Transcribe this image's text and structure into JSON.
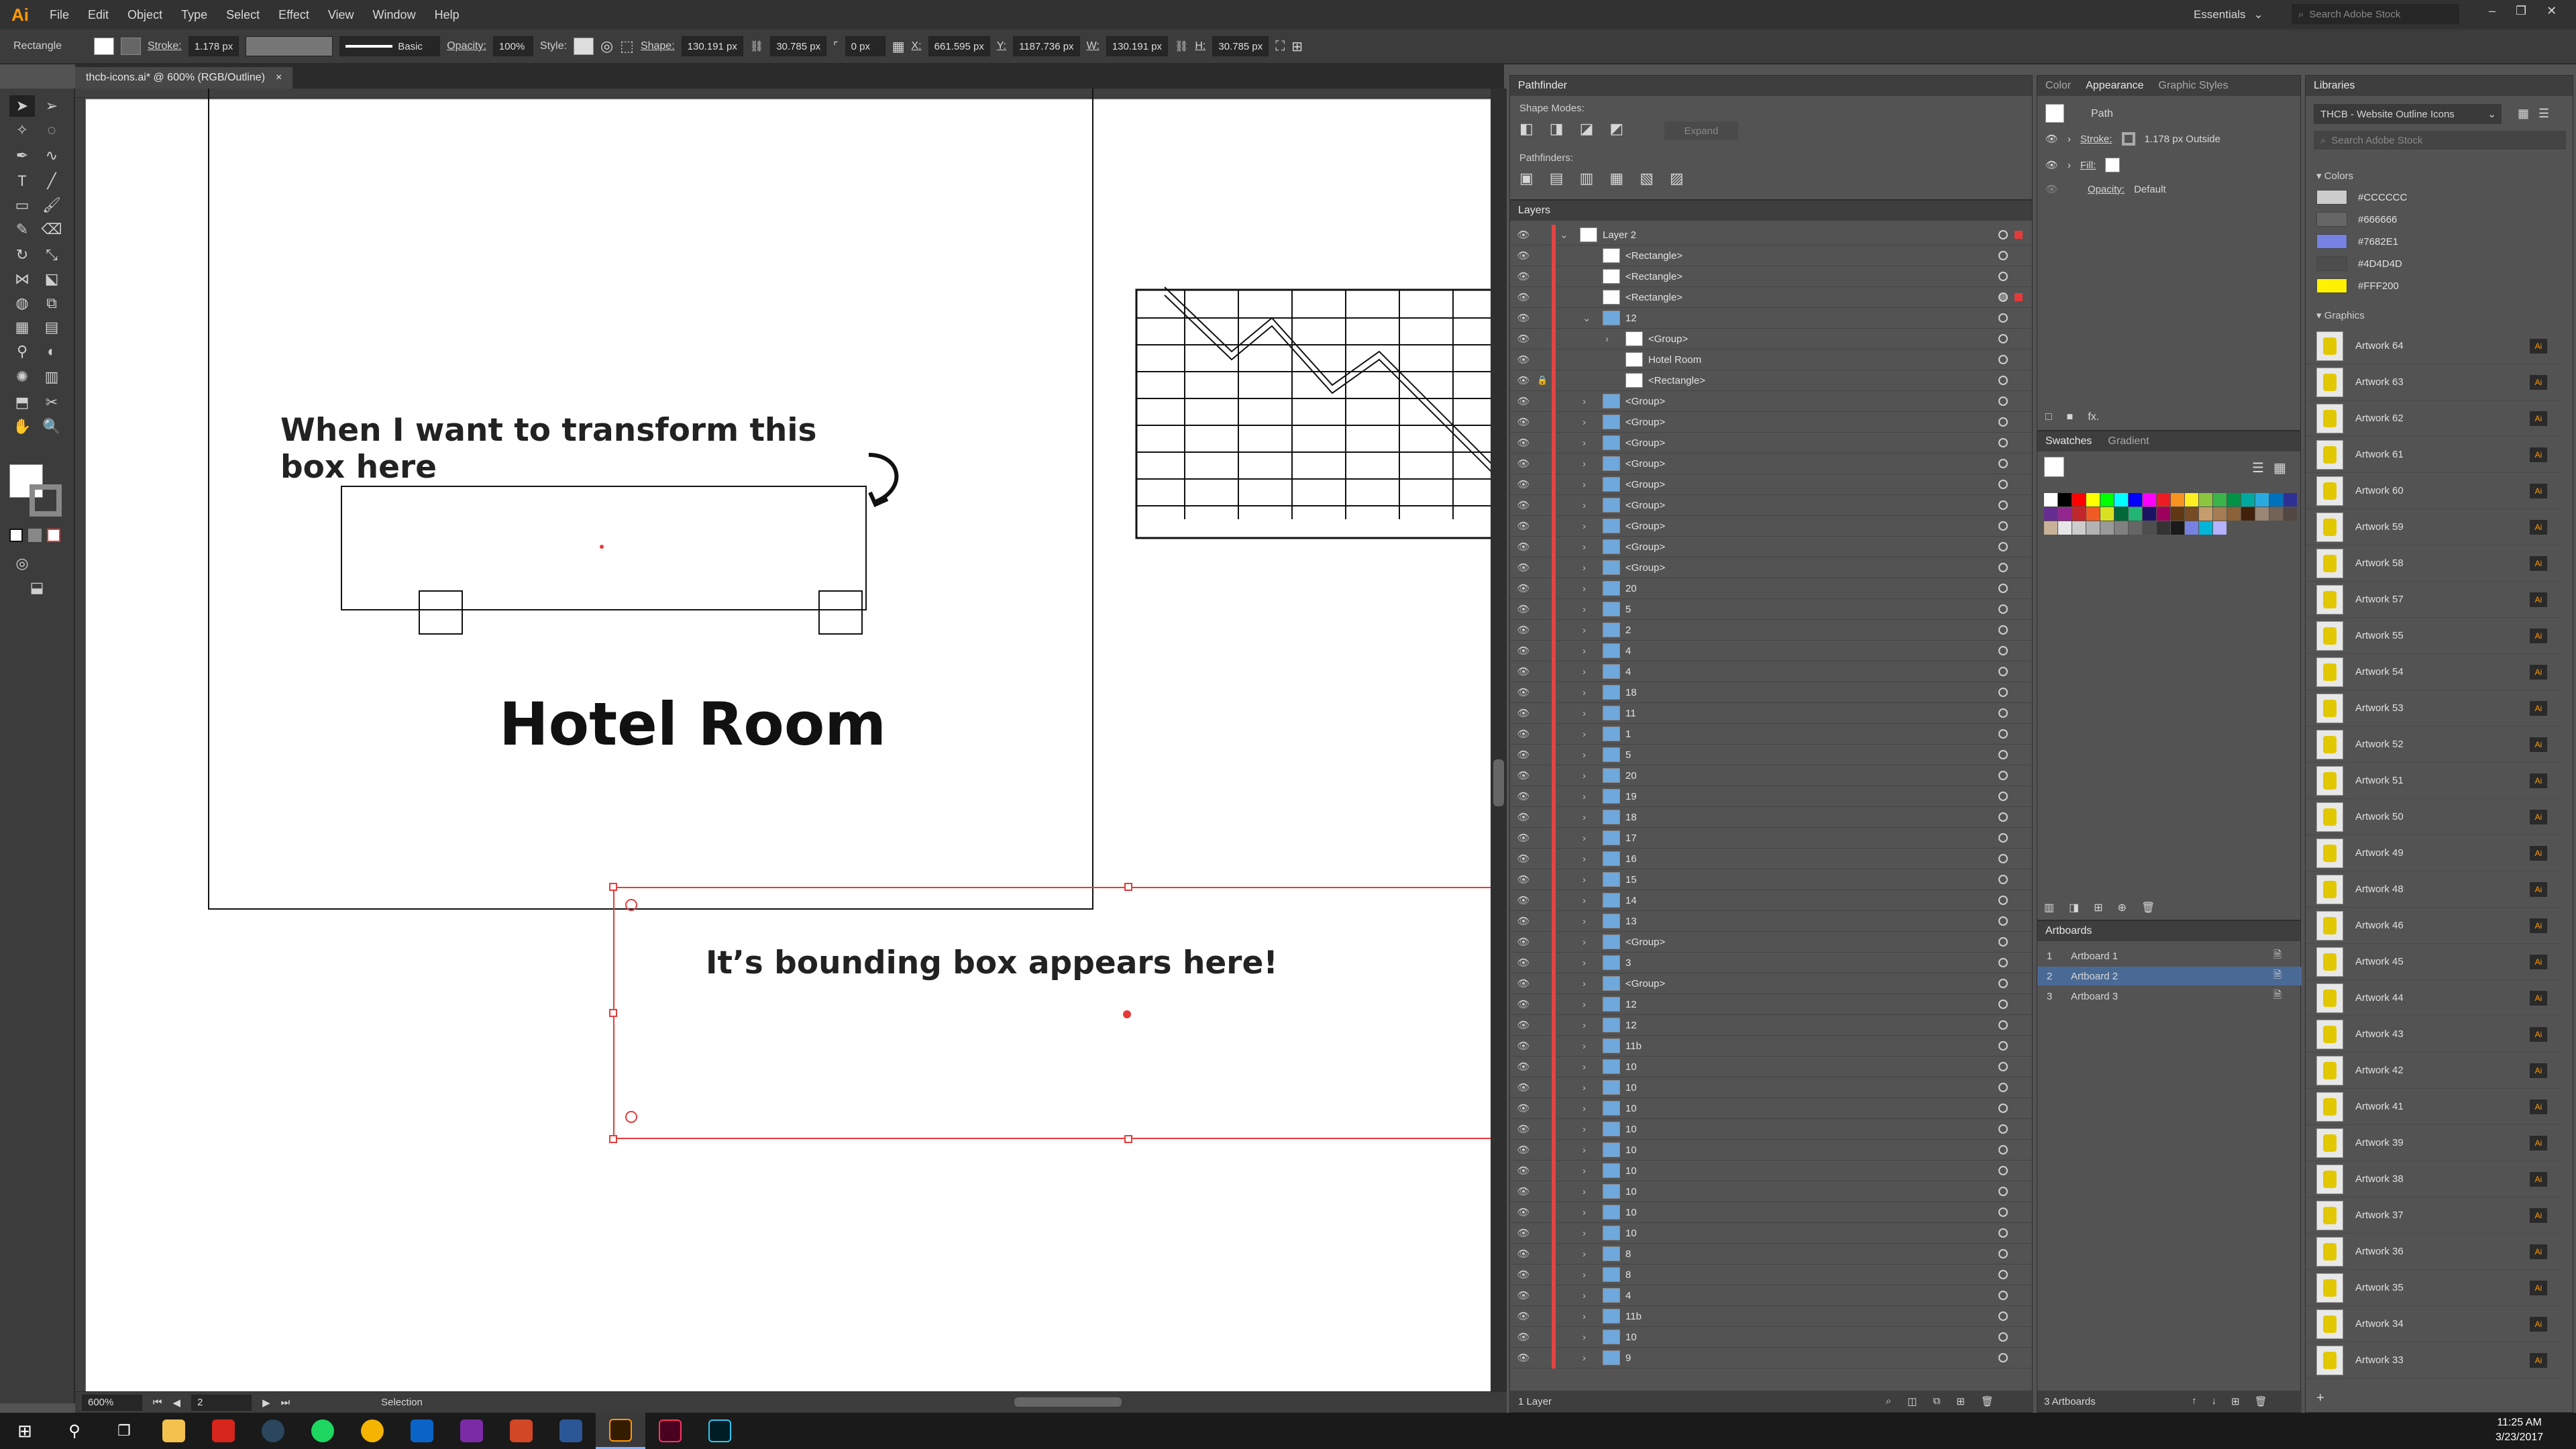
{
  "app": {
    "logo": "Ai"
  },
  "menu": [
    "File",
    "Edit",
    "Object",
    "Type",
    "Select",
    "Effect",
    "View",
    "Window",
    "Help"
  ],
  "workspace": {
    "label": "Essentials",
    "search_placeholder": "Search Adobe Stock"
  },
  "control": {
    "object_type": "Rectangle",
    "stroke_label": "Stroke:",
    "stroke_value": "1.178 px",
    "brush_label": "Basic",
    "opacity_label": "Opacity:",
    "opacity_value": "100%",
    "style_label": "Style:",
    "shape_label": "Shape:",
    "shape_w": "130.191 px",
    "shape_h": "30.785 px",
    "corner": "0 px",
    "x_label": "X:",
    "x_value": "661.595 px",
    "y_label": "Y:",
    "y_value": "1187.736 px",
    "w_label": "W:",
    "w_value": "130.191 px",
    "h_label": "H:",
    "h_value": "30.785 px"
  },
  "document": {
    "tab": "thcb-icons.ai* @ 600% (RGB/Outline)",
    "close": "×"
  },
  "artboard": {
    "caption_top": "When I want to transform this box here",
    "title": "Hotel Room",
    "caption_bottom": "It’s bounding box appears here!"
  },
  "status": {
    "zoom": "600%",
    "artboard_num": "2",
    "tool": "Selection"
  },
  "pathfinder": {
    "title": "Pathfinder",
    "shape_modes": "Shape Modes:",
    "expand": "Expand",
    "pathfinders": "Pathfinders:"
  },
  "layers": {
    "title": "Layers",
    "footer": "1 Layer",
    "rows": [
      {
        "name": "Layer 2",
        "indent": 0,
        "expand": "open",
        "thumb": "white"
      },
      {
        "name": "<Rectangle>",
        "indent": 1,
        "expand": "",
        "thumb": "white"
      },
      {
        "name": "<Rectangle>",
        "indent": 1,
        "expand": "",
        "thumb": "white"
      },
      {
        "name": "<Rectangle>",
        "indent": 1,
        "expand": "",
        "thumb": "white"
      },
      {
        "name": "12",
        "indent": 1,
        "expand": "open",
        "thumb": "blue"
      },
      {
        "name": "<Group>",
        "indent": 2,
        "expand": "closed",
        "thumb": "white"
      },
      {
        "name": "Hotel Room",
        "indent": 2,
        "expand": "",
        "thumb": "white"
      },
      {
        "name": "<Rectangle>",
        "indent": 2,
        "expand": "",
        "thumb": "white"
      },
      {
        "name": "<Group>",
        "indent": 1,
        "expand": "closed",
        "thumb": "blue"
      },
      {
        "name": "<Group>",
        "indent": 1,
        "expand": "closed",
        "thumb": "blue"
      },
      {
        "name": "<Group>",
        "indent": 1,
        "expand": "closed",
        "thumb": "blue"
      },
      {
        "name": "<Group>",
        "indent": 1,
        "expand": "closed",
        "thumb": "blue"
      },
      {
        "name": "<Group>",
        "indent": 1,
        "expand": "closed",
        "thumb": "blue"
      },
      {
        "name": "<Group>",
        "indent": 1,
        "expand": "closed",
        "thumb": "blue"
      },
      {
        "name": "<Group>",
        "indent": 1,
        "expand": "closed",
        "thumb": "blue"
      },
      {
        "name": "<Group>",
        "indent": 1,
        "expand": "closed",
        "thumb": "blue"
      },
      {
        "name": "<Group>",
        "indent": 1,
        "expand": "closed",
        "thumb": "blue"
      },
      {
        "name": "20",
        "indent": 1,
        "expand": "closed",
        "thumb": "blue"
      },
      {
        "name": "5",
        "indent": 1,
        "expand": "closed",
        "thumb": "blue"
      },
      {
        "name": "2",
        "indent": 1,
        "expand": "closed",
        "thumb": "blue"
      },
      {
        "name": "4",
        "indent": 1,
        "expand": "closed",
        "thumb": "blue"
      },
      {
        "name": "4",
        "indent": 1,
        "expand": "closed",
        "thumb": "blue"
      },
      {
        "name": "18",
        "indent": 1,
        "expand": "closed",
        "thumb": "blue"
      },
      {
        "name": "11",
        "indent": 1,
        "expand": "closed",
        "thumb": "blue"
      },
      {
        "name": "1",
        "indent": 1,
        "expand": "closed",
        "thumb": "blue"
      },
      {
        "name": "5",
        "indent": 1,
        "expand": "closed",
        "thumb": "blue"
      },
      {
        "name": "20",
        "indent": 1,
        "expand": "closed",
        "thumb": "blue"
      },
      {
        "name": "19",
        "indent": 1,
        "expand": "closed",
        "thumb": "blue"
      },
      {
        "name": "18",
        "indent": 1,
        "expand": "closed",
        "thumb": "blue"
      },
      {
        "name": "17",
        "indent": 1,
        "expand": "closed",
        "thumb": "blue"
      },
      {
        "name": "16",
        "indent": 1,
        "expand": "closed",
        "thumb": "blue"
      },
      {
        "name": "15",
        "indent": 1,
        "expand": "closed",
        "thumb": "blue"
      },
      {
        "name": "14",
        "indent": 1,
        "expand": "closed",
        "thumb": "blue"
      },
      {
        "name": "13",
        "indent": 1,
        "expand": "closed",
        "thumb": "blue"
      },
      {
        "name": "<Group>",
        "indent": 1,
        "expand": "closed",
        "thumb": "blue"
      },
      {
        "name": "3",
        "indent": 1,
        "expand": "closed",
        "thumb": "blue"
      },
      {
        "name": "<Group>",
        "indent": 1,
        "expand": "closed",
        "thumb": "blue"
      },
      {
        "name": "12",
        "indent": 1,
        "expand": "closed",
        "thumb": "blue"
      },
      {
        "name": "12",
        "indent": 1,
        "expand": "closed",
        "thumb": "blue"
      },
      {
        "name": "11b",
        "indent": 1,
        "expand": "closed",
        "thumb": "blue"
      },
      {
        "name": "10",
        "indent": 1,
        "expand": "closed",
        "thumb": "blue"
      },
      {
        "name": "10",
        "indent": 1,
        "expand": "closed",
        "thumb": "blue"
      },
      {
        "name": "10",
        "indent": 1,
        "expand": "closed",
        "thumb": "blue"
      },
      {
        "name": "10",
        "indent": 1,
        "expand": "closed",
        "thumb": "blue"
      },
      {
        "name": "10",
        "indent": 1,
        "expand": "closed",
        "thumb": "blue"
      },
      {
        "name": "10",
        "indent": 1,
        "expand": "closed",
        "thumb": "blue"
      },
      {
        "name": "10",
        "indent": 1,
        "expand": "closed",
        "thumb": "blue"
      },
      {
        "name": "10",
        "indent": 1,
        "expand": "closed",
        "thumb": "blue"
      },
      {
        "name": "10",
        "indent": 1,
        "expand": "closed",
        "thumb": "blue"
      },
      {
        "name": "8",
        "indent": 1,
        "expand": "closed",
        "thumb": "blue"
      },
      {
        "name": "8",
        "indent": 1,
        "expand": "closed",
        "thumb": "blue"
      },
      {
        "name": "4",
        "indent": 1,
        "expand": "closed",
        "thumb": "blue"
      },
      {
        "name": "11b",
        "indent": 1,
        "expand": "closed",
        "thumb": "blue"
      },
      {
        "name": "10",
        "indent": 1,
        "expand": "closed",
        "thumb": "blue"
      },
      {
        "name": "9",
        "indent": 1,
        "expand": "closed",
        "thumb": "blue"
      }
    ]
  },
  "appearance": {
    "tabs": [
      "Color",
      "Appearance",
      "Graphic Styles"
    ],
    "target": "Path",
    "stroke_label": "Stroke:",
    "stroke_value": "1.178 px  Outside",
    "fill_label": "Fill:",
    "opacity_label": "Opacity:",
    "opacity_value": "Default",
    "fx": "fx."
  },
  "swatches": {
    "tabs": [
      "Swatches",
      "Gradient"
    ]
  },
  "artboards": {
    "title": "Artboards",
    "footer": "3 Artboards",
    "items": [
      {
        "num": "1",
        "name": "Artboard 1"
      },
      {
        "num": "2",
        "name": "Artboard 2"
      },
      {
        "num": "3",
        "name": "Artboard 3"
      }
    ]
  },
  "libraries": {
    "title": "Libraries",
    "library_name": "THCB - Website Outline Icons",
    "search_placeholder": "Search Adobe Stock",
    "colors_heading": "Colors",
    "colors": [
      {
        "name": "#CCCCCC",
        "hex": "#CCCCCC"
      },
      {
        "name": "#666666",
        "hex": "#666666"
      },
      {
        "name": "#7682E1",
        "hex": "#7682E1"
      },
      {
        "name": "#4D4D4D",
        "hex": "#4D4D4D"
      },
      {
        "name": "#FFF200",
        "hex": "#FFF200"
      }
    ],
    "graphics_heading": "Graphics",
    "graphics": [
      "Artwork 64",
      "Artwork 63",
      "Artwork 62",
      "Artwork 61",
      "Artwork 60",
      "Artwork 59",
      "Artwork 58",
      "Artwork 57",
      "Artwork 55",
      "Artwork 54",
      "Artwork 53",
      "Artwork 52",
      "Artwork 51",
      "Artwork 50",
      "Artwork 49",
      "Artwork 48",
      "Artwork 46",
      "Artwork 45",
      "Artwork 44",
      "Artwork 43",
      "Artwork 42",
      "Artwork 41",
      "Artwork 39",
      "Artwork 38",
      "Artwork 37",
      "Artwork 36",
      "Artwork 35",
      "Artwork 34",
      "Artwork 33"
    ],
    "badge": "Ai"
  },
  "taskbar": {
    "time": "11:25 AM",
    "date": "3/23/2017"
  },
  "colors": {
    "selection": "#e53a3a",
    "accent": "#ff9a00",
    "layer_blue": "#6fa8dc"
  }
}
